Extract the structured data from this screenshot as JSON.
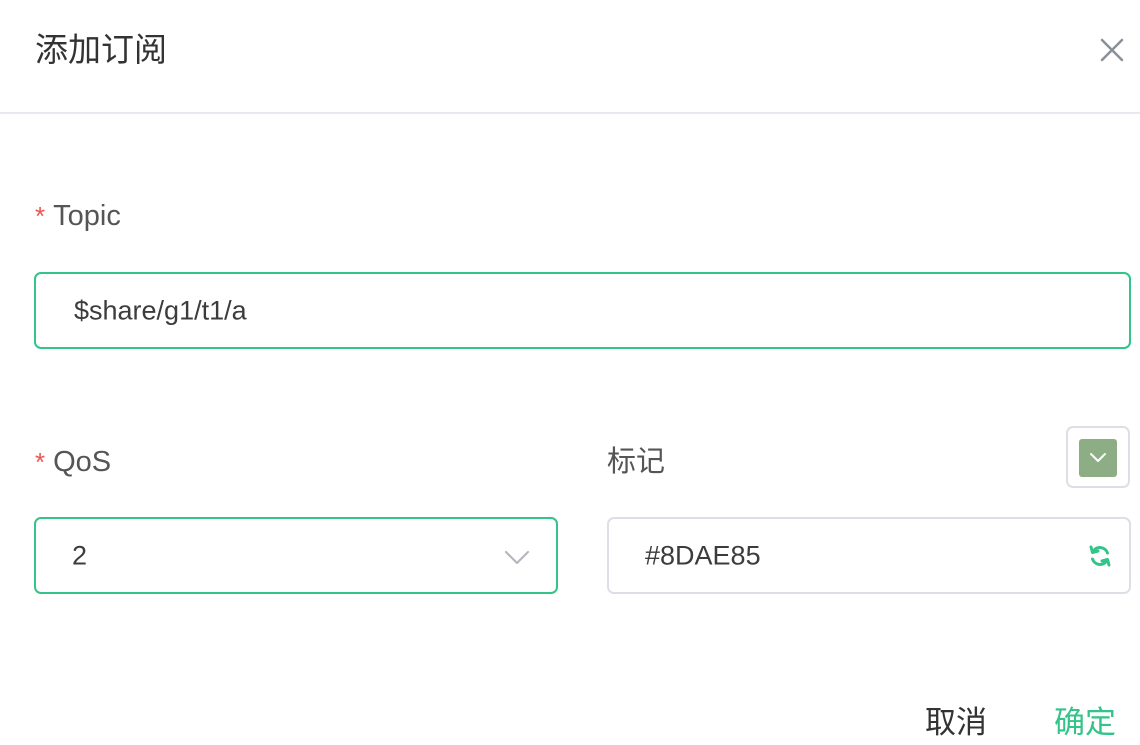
{
  "dialog": {
    "title": "添加订阅",
    "close_icon": "close-icon"
  },
  "topic": {
    "required_mark": "*",
    "label": "Topic",
    "value": "$share/g1/t1/a"
  },
  "qos": {
    "required_mark": "*",
    "label": "QoS",
    "value": "2",
    "dropdown_icon": "chevron-down-icon"
  },
  "mark": {
    "label": "标记",
    "value": "#8DAE85",
    "swatch_color": "#8DAE85",
    "refresh_icon": "refresh-icon"
  },
  "footer": {
    "cancel_label": "取消",
    "confirm_label": "确定"
  },
  "colors": {
    "accent": "#34C388",
    "required": "#EF5350",
    "border": "#DCDFE6"
  }
}
